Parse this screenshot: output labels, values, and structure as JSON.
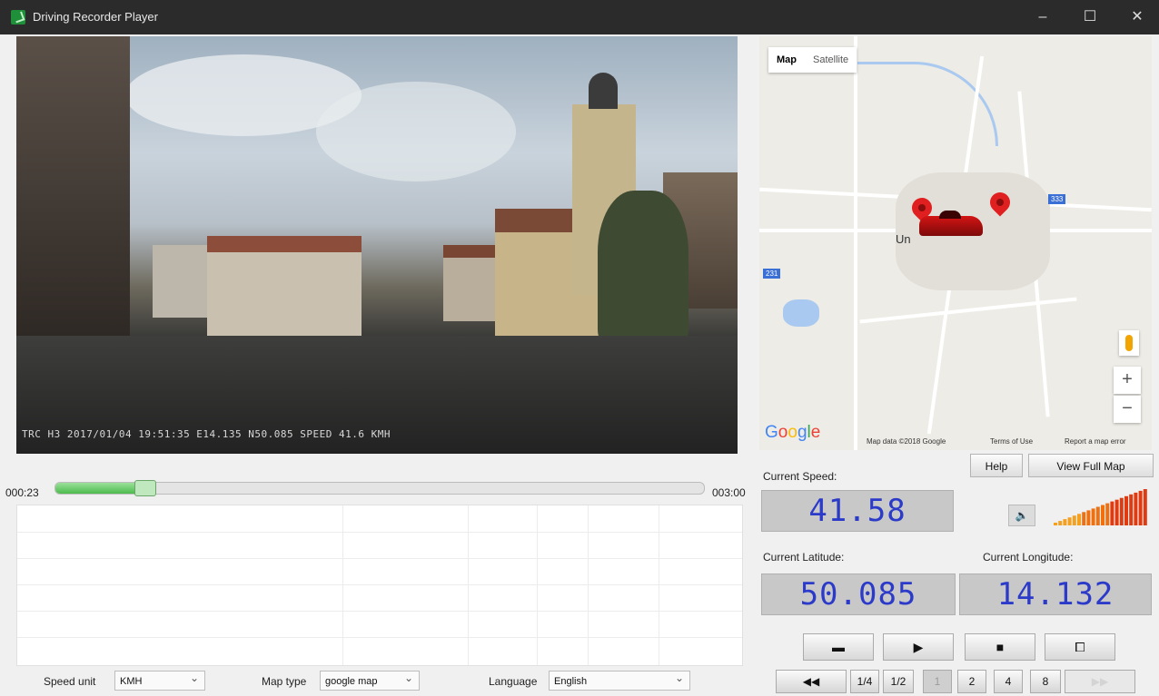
{
  "window": {
    "title": "Driving Recorder Player",
    "minimize": "–",
    "maximize": "☐",
    "close": "✕"
  },
  "video": {
    "overlay": "TRC H3    2017/01/04  19:51:35  E14.135  N50.085  SPEED 41.6  KMH"
  },
  "map": {
    "tabs": [
      "Map",
      "Satellite"
    ],
    "town_label": "Un",
    "road_badges": [
      "231",
      "333"
    ],
    "zoom_in": "+",
    "zoom_out": "−",
    "logo": [
      "G",
      "o",
      "o",
      "g",
      "l",
      "e"
    ],
    "footer": {
      "data": "Map data ©2018 Google",
      "terms": "Terms of Use",
      "report": "Report a map error"
    }
  },
  "playback": {
    "current_time": "000:23",
    "total_time": "003:00",
    "progress": 0.13
  },
  "options": {
    "speed_unit_label": "Speed unit",
    "speed_unit_value": "KMH",
    "map_type_label": "Map type",
    "map_type_value": "google map",
    "language_label": "Language",
    "language_value": "English"
  },
  "panel": {
    "help": "Help",
    "view_full_map": "View Full Map",
    "speed_label": "Current Speed:",
    "speed_value": "41.58",
    "latitude_label": "Current Latitude:",
    "latitude_value": "50.085",
    "longitude_label": "Current Longitude:",
    "longitude_value": "14.132",
    "volume_icon": "🔈"
  },
  "controls": {
    "open": "▬",
    "play": "▶",
    "stop": "■",
    "crop": "⧠",
    "rewind": "◀◀",
    "forward": "▶▶",
    "speeds": [
      "1/4",
      "1/2",
      "1",
      "2",
      "4",
      "8"
    ]
  },
  "colors": {
    "lcd_text": "#2b3ac9",
    "progress_fill": "#4cbb4c",
    "volume_bar": "#f07010"
  }
}
